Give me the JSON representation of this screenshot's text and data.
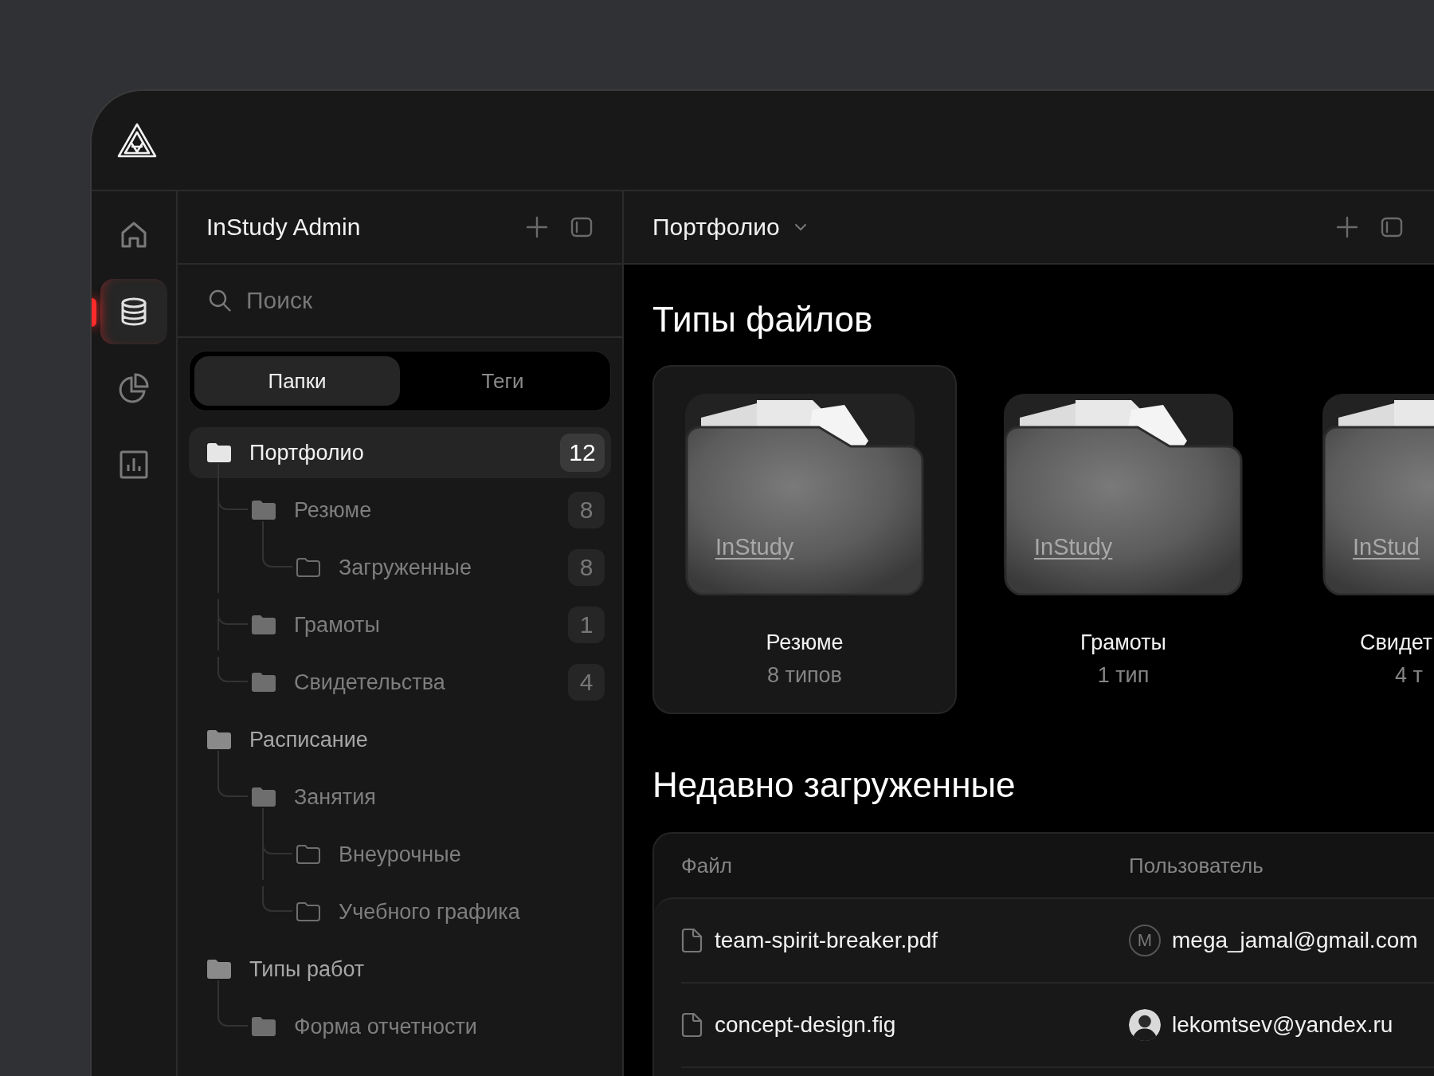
{
  "nav": [
    {
      "kind": "home",
      "selected": false
    },
    {
      "kind": "database",
      "selected": true
    },
    {
      "kind": "pie",
      "selected": false
    },
    {
      "kind": "bars",
      "selected": false
    }
  ],
  "sidebar": {
    "title": "InStudy Admin",
    "search": {
      "placeholder": "Поиск"
    },
    "tabs": [
      {
        "label": "Папки",
        "selected": true
      },
      {
        "label": "Теги",
        "selected": false
      }
    ],
    "tree": [
      {
        "label": "Портфолио",
        "count": "12",
        "kind": "filled",
        "selected": true,
        "children": [
          {
            "label": "Резюме",
            "count": "8",
            "kind": "filled",
            "selected": false,
            "children": [
              {
                "label": "Загруженные",
                "count": "8",
                "kind": "outline",
                "selected": false
              }
            ]
          },
          {
            "label": "Грамоты",
            "count": "1",
            "kind": "filled",
            "selected": false
          },
          {
            "label": "Свидетельства",
            "count": "4",
            "kind": "filled",
            "selected": false
          }
        ]
      },
      {
        "label": "Расписание",
        "kind": "filled",
        "selected": false,
        "children": [
          {
            "label": "Занятия",
            "kind": "filled",
            "selected": false,
            "children": [
              {
                "label": "Внеурочные",
                "kind": "outline",
                "selected": false
              },
              {
                "label": "Учебного графика",
                "kind": "outline",
                "selected": false
              }
            ]
          }
        ]
      },
      {
        "label": "Типы работ",
        "kind": "filled",
        "selected": false,
        "children": [
          {
            "label": "Форма отчетности",
            "kind": "filled",
            "selected": false
          }
        ]
      }
    ]
  },
  "main": {
    "title": "Портфолио",
    "section_title": "Типы файлов",
    "file_types": [
      {
        "name": "Резюме",
        "subtitle": "8 типов",
        "label": "InStudy",
        "selected": true
      },
      {
        "name": "Грамоты",
        "subtitle": "1 тип",
        "label": "InStudy",
        "selected": false
      },
      {
        "name": "Свидет",
        "subtitle": "4 т",
        "label": "InStud",
        "selected": false
      }
    ],
    "recent_title": "Недавно загруженные",
    "table": {
      "columns": [
        "Файл",
        "Пользователь"
      ],
      "rows": [
        {
          "file": "team-spirit-breaker.pdf",
          "user": "mega_jamal@gmail.com",
          "avatar": {
            "kind": "letter",
            "initial": "M"
          }
        },
        {
          "file": "concept-design.fig",
          "user": "lekomtsev@yandex.ru",
          "avatar": {
            "kind": "photo"
          }
        }
      ]
    }
  }
}
